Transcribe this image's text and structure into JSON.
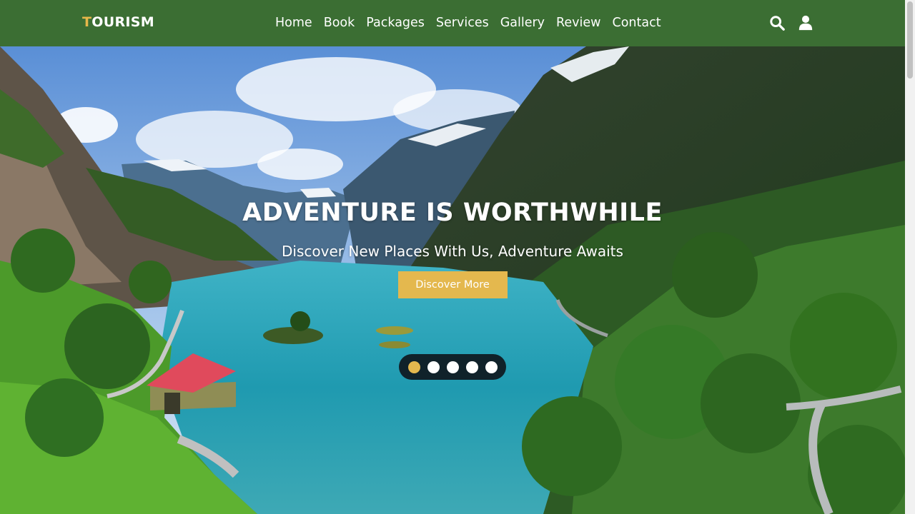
{
  "header": {
    "logo_first": "T",
    "logo_rest": "OURISM",
    "nav": [
      "Home",
      "Book",
      "Packages",
      "Services",
      "Gallery",
      "Review",
      "Contact"
    ],
    "icons": [
      "search-icon",
      "user-icon"
    ]
  },
  "hero": {
    "title": "ADVENTURE IS WORTHWHILE",
    "subtitle": "Discover New Places With Us, Adventure Awaits",
    "button": "Discover More",
    "slide_count": 5,
    "active_slide": 1
  },
  "colors": {
    "header_bg": "#3b6e33",
    "accent": "#e4b84e",
    "dots_bg": "#10222a"
  }
}
